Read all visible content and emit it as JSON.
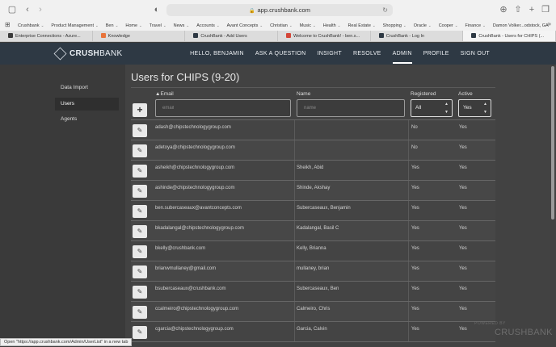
{
  "browser": {
    "url": "app.crushbank.com",
    "bookmarks": [
      "Crushbank",
      "Product Management",
      "Ben",
      "Home",
      "Travel",
      "News",
      "Accounts",
      "Avant Concepts",
      "Christian",
      "Music",
      "Health",
      "Real Estate",
      "Shopping",
      "Oracle",
      "Cooper",
      "Finance",
      "Damon Volker...odstock, GA"
    ],
    "tabs": [
      {
        "label": "Enterprise Connections - Azure...",
        "color": "#3b3b3b"
      },
      {
        "label": "Knowledge",
        "color": "#e8743b"
      },
      {
        "label": "CrushBank - Add Users",
        "color": "#2e3944"
      },
      {
        "label": "Welcome to CrushBank! - ben.s...",
        "color": "#d44638"
      },
      {
        "label": "CrushBank - Log In",
        "color": "#2e3944"
      },
      {
        "label": "CrushBank - Users for CHIPS (...",
        "color": "#2e3944"
      }
    ],
    "status_text": "Open \"https://app.crushbank.com/Admin/UserList\" in a new tab"
  },
  "header": {
    "logo": {
      "bold": "CRUSH",
      "light": "BANK"
    },
    "nav": [
      "HELLO, BENJAMIN",
      "ASK A QUESTION",
      "INSIGHT",
      "RESOLVE",
      "ADMIN",
      "PROFILE",
      "SIGN OUT"
    ],
    "active_nav": "ADMIN"
  },
  "sidebar": {
    "items": [
      "Data Import",
      "Users",
      "Agents"
    ],
    "active": "Users"
  },
  "main": {
    "title": "Users for CHIPS (9-20)",
    "columns": {
      "email": "Email",
      "name": "Name",
      "registered": "Registered",
      "active": "Active"
    },
    "sort_indicator": "▲",
    "filters": {
      "email_placeholder": "email",
      "name_placeholder": "name",
      "registered_value": "All",
      "active_value": "Yes"
    },
    "rows": [
      {
        "email": "adash@chipstechnologygroup.com",
        "name": "",
        "registered": "No",
        "active": "Yes"
      },
      {
        "email": "adetoya@chipstechnologygroup.com",
        "name": "",
        "registered": "No",
        "active": "Yes"
      },
      {
        "email": "asheikh@chipstechnologygroup.com",
        "name": "Sheikh, Abid",
        "registered": "Yes",
        "active": "Yes"
      },
      {
        "email": "ashinde@chipstechnologygroup.com",
        "name": "Shinde, Akshay",
        "registered": "Yes",
        "active": "Yes"
      },
      {
        "email": "ben.subercaseaux@avantconcepts.com",
        "name": "Subercaseaux, Benjamin",
        "registered": "Yes",
        "active": "Yes"
      },
      {
        "email": "bkadalangal@chipstechnologygroup.com",
        "name": "Kadalangal, Basil C",
        "registered": "Yes",
        "active": "Yes"
      },
      {
        "email": "bkelly@crushbank.com",
        "name": "Kelly, Brianna",
        "registered": "Yes",
        "active": "Yes"
      },
      {
        "email": "brianwmullaney@gmail.com",
        "name": "mullaney, brian",
        "registered": "Yes",
        "active": "Yes"
      },
      {
        "email": "bsubercaseaux@crushbank.com",
        "name": "Subercaseaux, Ben",
        "registered": "Yes",
        "active": "Yes"
      },
      {
        "email": "ccalmeiro@chipstechnologygroup.com",
        "name": "Calmeiro, Chris",
        "registered": "Yes",
        "active": "Yes"
      },
      {
        "email": "cgarcia@chipstechnologygroup.com",
        "name": "Garcia, Calvin",
        "registered": "Yes",
        "active": "Yes"
      }
    ]
  },
  "footer": {
    "powered_by": "POWERED BY",
    "brand": "CRUSHBANK"
  }
}
